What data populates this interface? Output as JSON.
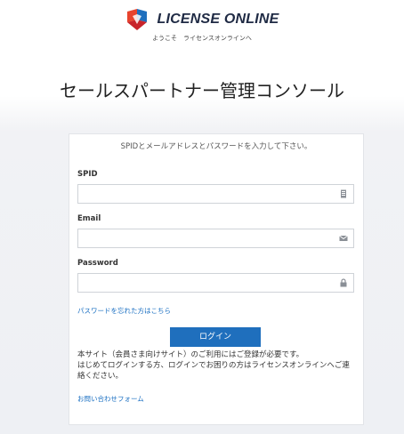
{
  "header": {
    "brand": "LICENSE ONLINE",
    "welcome": "ようこそ　ライセンスオンラインへ",
    "logo_colors": [
      "#e8432d",
      "#1f6fbd",
      "#c8242b"
    ]
  },
  "console_title": "セールスパートナー管理コンソール",
  "form": {
    "intro": "SPIDとメールアドレスとパスワードを入力して下さい。",
    "fields": [
      {
        "label": "SPID",
        "value": "",
        "placeholder": "",
        "icon": "id-card-icon"
      },
      {
        "label": "Email",
        "value": "",
        "placeholder": "",
        "icon": "envelope-icon"
      },
      {
        "label": "Password",
        "value": "",
        "placeholder": "",
        "icon": "lock-icon"
      }
    ],
    "forgot_link": "パスワードを忘れた方はこちら",
    "login_button": "ログイン",
    "notice_line1": "本サイト（会員さま向けサイト）のご利用にはご登録が必要です。",
    "notice_line2": "はじめてログインする方、ログインでお困りの方はライセンスオンラインへご連絡ください。",
    "contact_link": "お問い合わせフォーム",
    "accent_color": "#1f6fbd",
    "link_color": "#1a6fc2"
  }
}
